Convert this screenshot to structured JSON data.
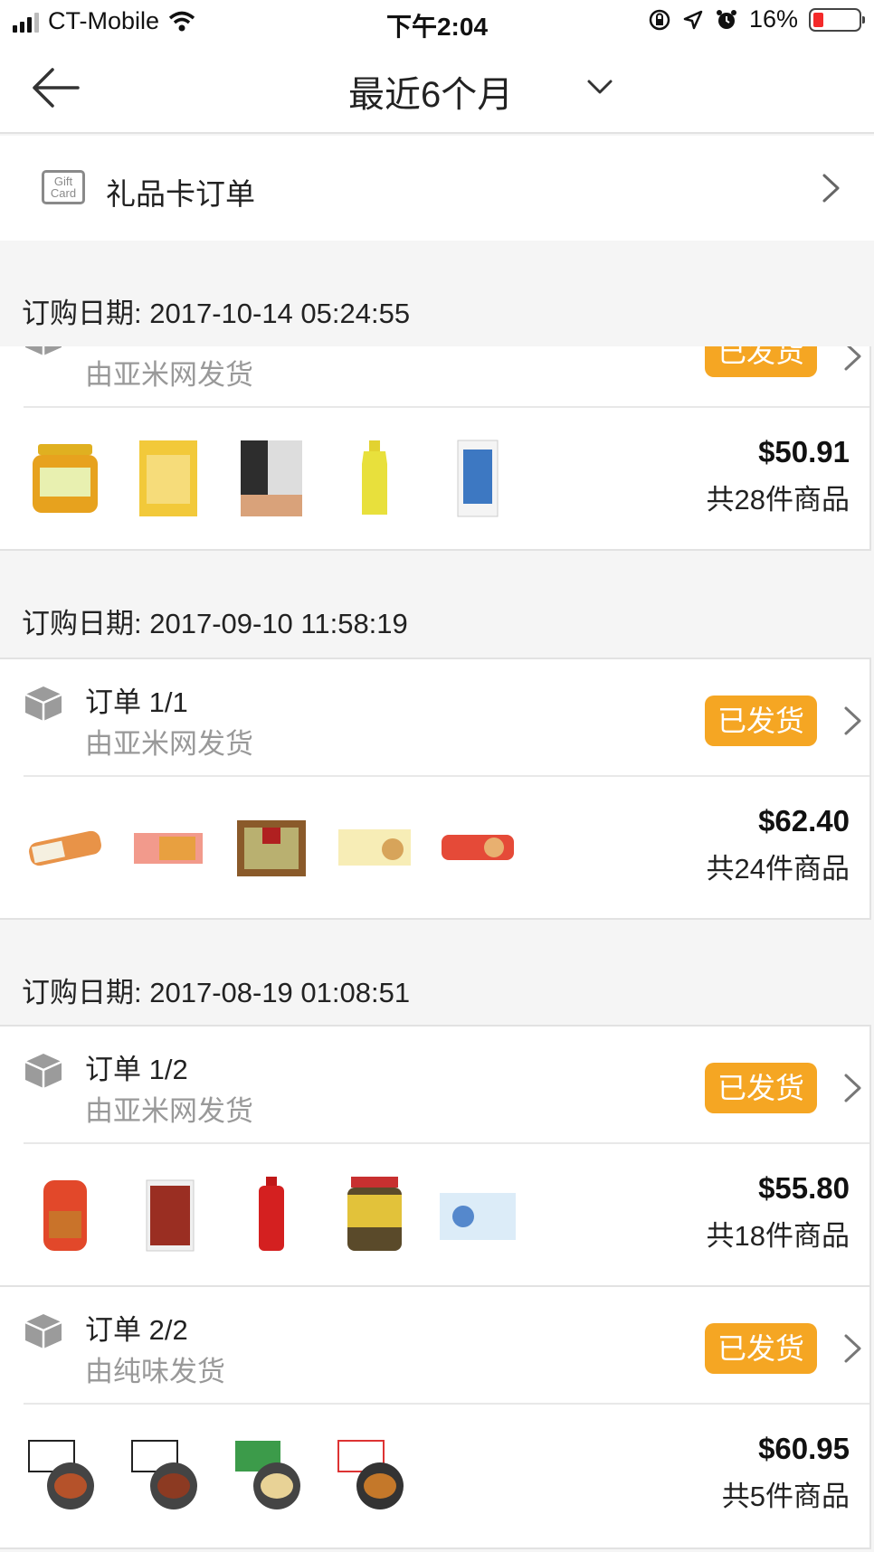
{
  "status_bar": {
    "carrier": "CT-Mobile",
    "time": "下午2:04",
    "battery_pct": "16%"
  },
  "nav": {
    "title": "最近6个月"
  },
  "gift_card": {
    "icon_text": "Gift Card",
    "label": "礼品卡订单"
  },
  "colors": {
    "badge": "#f5a623",
    "battery_low": "#f42a2a"
  },
  "groups": [
    {
      "date": "订购日期: 2017-10-14 05:24:55"
    },
    {
      "date": "订购日期: 2017-09-10 11:58:19"
    },
    {
      "date": "订购日期: 2017-08-19 01:08:51"
    }
  ],
  "orders": [
    {
      "order_no": "",
      "shipper": "由亚米网发货",
      "status": "已发货",
      "price": "$50.91",
      "count": "共28件商品"
    },
    {
      "order_no": "订单 1/1",
      "shipper": "由亚米网发货",
      "status": "已发货",
      "price": "$62.40",
      "count": "共24件商品"
    },
    {
      "order_no": "订单 1/2",
      "shipper": "由亚米网发货",
      "status": "已发货",
      "price": "$55.80",
      "count": "共18件商品"
    },
    {
      "order_no": "订单 2/2",
      "shipper": "由纯味发货",
      "status": "已发货",
      "price": "$60.95",
      "count": "共5件商品"
    }
  ]
}
